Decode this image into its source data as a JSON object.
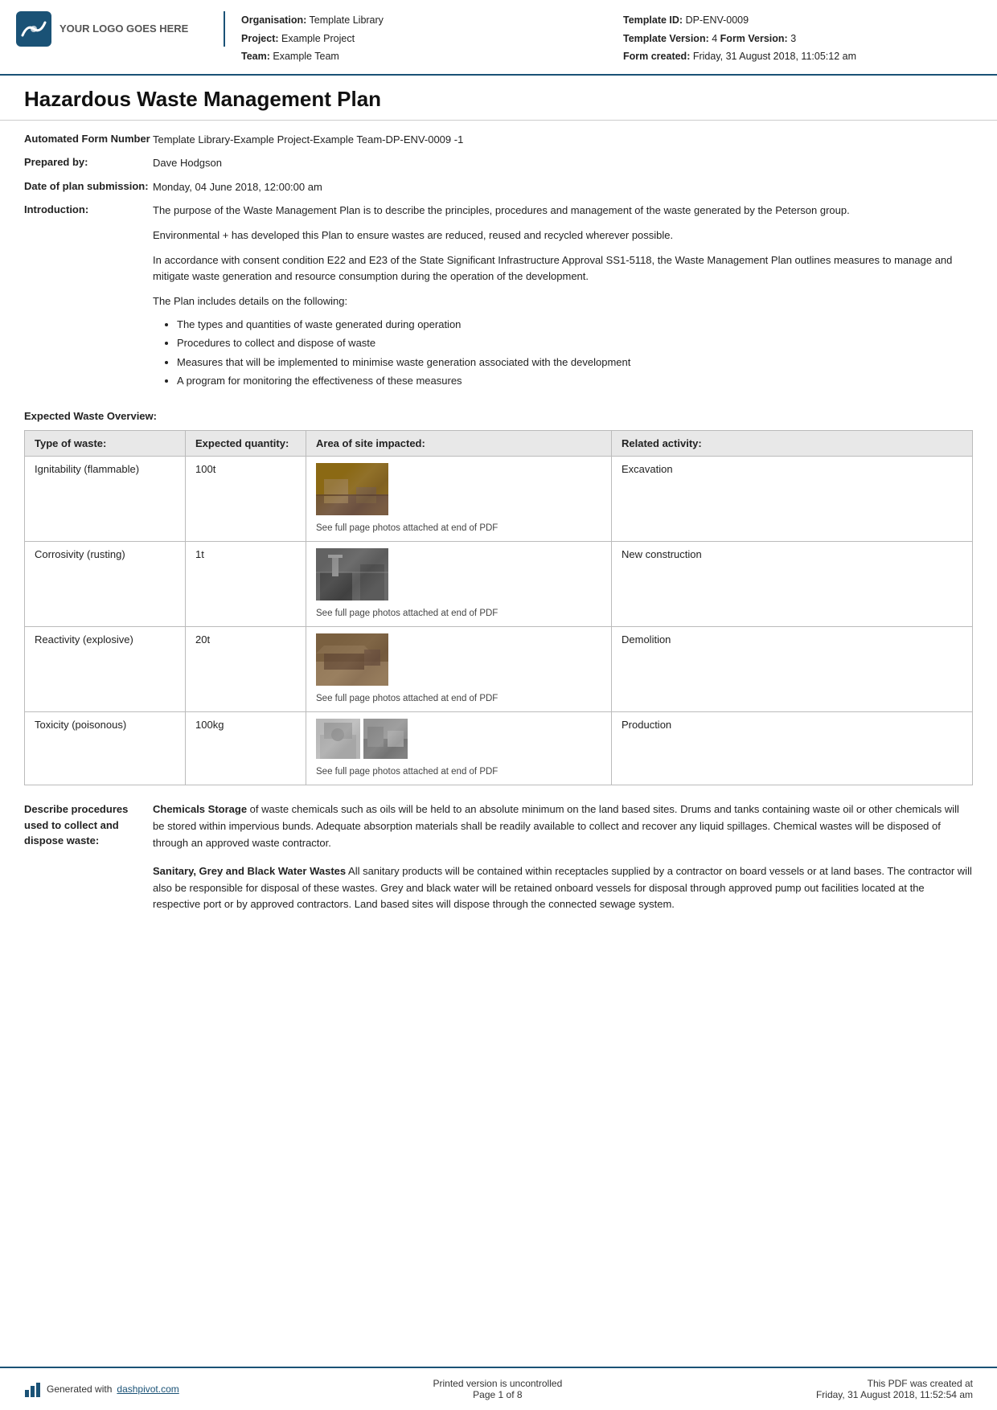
{
  "header": {
    "logo_text": "YOUR LOGO GOES HERE",
    "organisation_label": "Organisation:",
    "organisation_value": "Template Library",
    "project_label": "Project:",
    "project_value": "Example Project",
    "team_label": "Team:",
    "team_value": "Example Team",
    "template_id_label": "Template ID:",
    "template_id_value": "DP-ENV-0009",
    "template_version_label": "Template Version:",
    "template_version_value": "4",
    "form_version_label": "Form Version:",
    "form_version_value": "3",
    "form_created_label": "Form created:",
    "form_created_value": "Friday, 31 August 2018, 11:05:12 am"
  },
  "page_title": "Hazardous Waste Management Plan",
  "form_number_label": "Automated Form Number",
  "form_number_value": "Template Library-Example Project-Example Team-DP-ENV-0009   -1",
  "prepared_by_label": "Prepared by:",
  "prepared_by_value": "Dave Hodgson",
  "date_of_plan_label": "Date of plan submission:",
  "date_of_plan_value": "Monday, 04 June 2018, 12:00:00 am",
  "introduction_label": "Introduction:",
  "introduction_paragraphs": [
    "The purpose of the Waste Management Plan is to describe the principles, procedures and management of the waste generated by the Peterson group.",
    "Environmental + has developed this Plan to ensure wastes are reduced, reused and recycled wherever possible.",
    "In accordance with consent condition E22 and E23 of the State Significant Infrastructure Approval SS1-5118, the Waste Management Plan outlines measures to manage and mitigate waste generation and resource consumption during the operation of the development.",
    "The Plan includes details on the following:"
  ],
  "bullet_items": [
    "The types and quantities of waste generated during operation",
    "Procedures to collect and dispose of waste",
    "Measures that will be implemented to minimise waste generation associated with the development",
    "A program for monitoring the effectiveness of these measures"
  ],
  "waste_overview_heading": "Expected Waste Overview:",
  "waste_table": {
    "headers": [
      "Type of waste:",
      "Expected quantity:",
      "Area of site impacted:",
      "Related activity:"
    ],
    "rows": [
      {
        "type": "Ignitability (flammable)",
        "quantity": "100t",
        "img_caption": "See full page photos attached at end of PDF",
        "activity": "Excavation",
        "img_type": "single"
      },
      {
        "type": "Corrosivity (rusting)",
        "quantity": "1t",
        "img_caption": "See full page photos attached at end of PDF",
        "activity": "New construction",
        "img_type": "single"
      },
      {
        "type": "Reactivity (explosive)",
        "quantity": "20t",
        "img_caption": "See full page photos attached at end of PDF",
        "activity": "Demolition",
        "img_type": "single"
      },
      {
        "type": "Toxicity (poisonous)",
        "quantity": "100kg",
        "img_caption": "See full page photos attached at end of PDF",
        "activity": "Production",
        "img_type": "pair"
      }
    ]
  },
  "procedures_label": "Describe procedures used to collect and dispose waste:",
  "procedures_paragraphs": [
    {
      "bold_part": "Chemicals Storage",
      "text": " of waste chemicals such as oils will be held to an absolute minimum on the land based sites. Drums and tanks containing waste oil or other chemicals will be stored within impervious bunds. Adequate absorption materials shall be readily available to collect and recover any liquid spillages. Chemical wastes will be disposed of through an approved waste contractor."
    },
    {
      "bold_part": "Sanitary, Grey and Black Water Wastes",
      "text": " All sanitary products will be contained within receptacles supplied by a contractor on board vessels or at land bases. The contractor will also be responsible for disposal of these wastes. Grey and black water will be retained onboard vessels for disposal through approved pump out facilities located at the respective port or by approved contractors. Land based sites will dispose through the connected sewage system."
    }
  ],
  "footer": {
    "generated_text": "Generated with ",
    "generated_link": "dashpivot.com",
    "print_text": "Printed version is uncontrolled",
    "page_text": "Page 1 of 8",
    "pdf_text": "This PDF was created at",
    "pdf_date": "Friday, 31 August 2018, 11:52:54 am"
  }
}
